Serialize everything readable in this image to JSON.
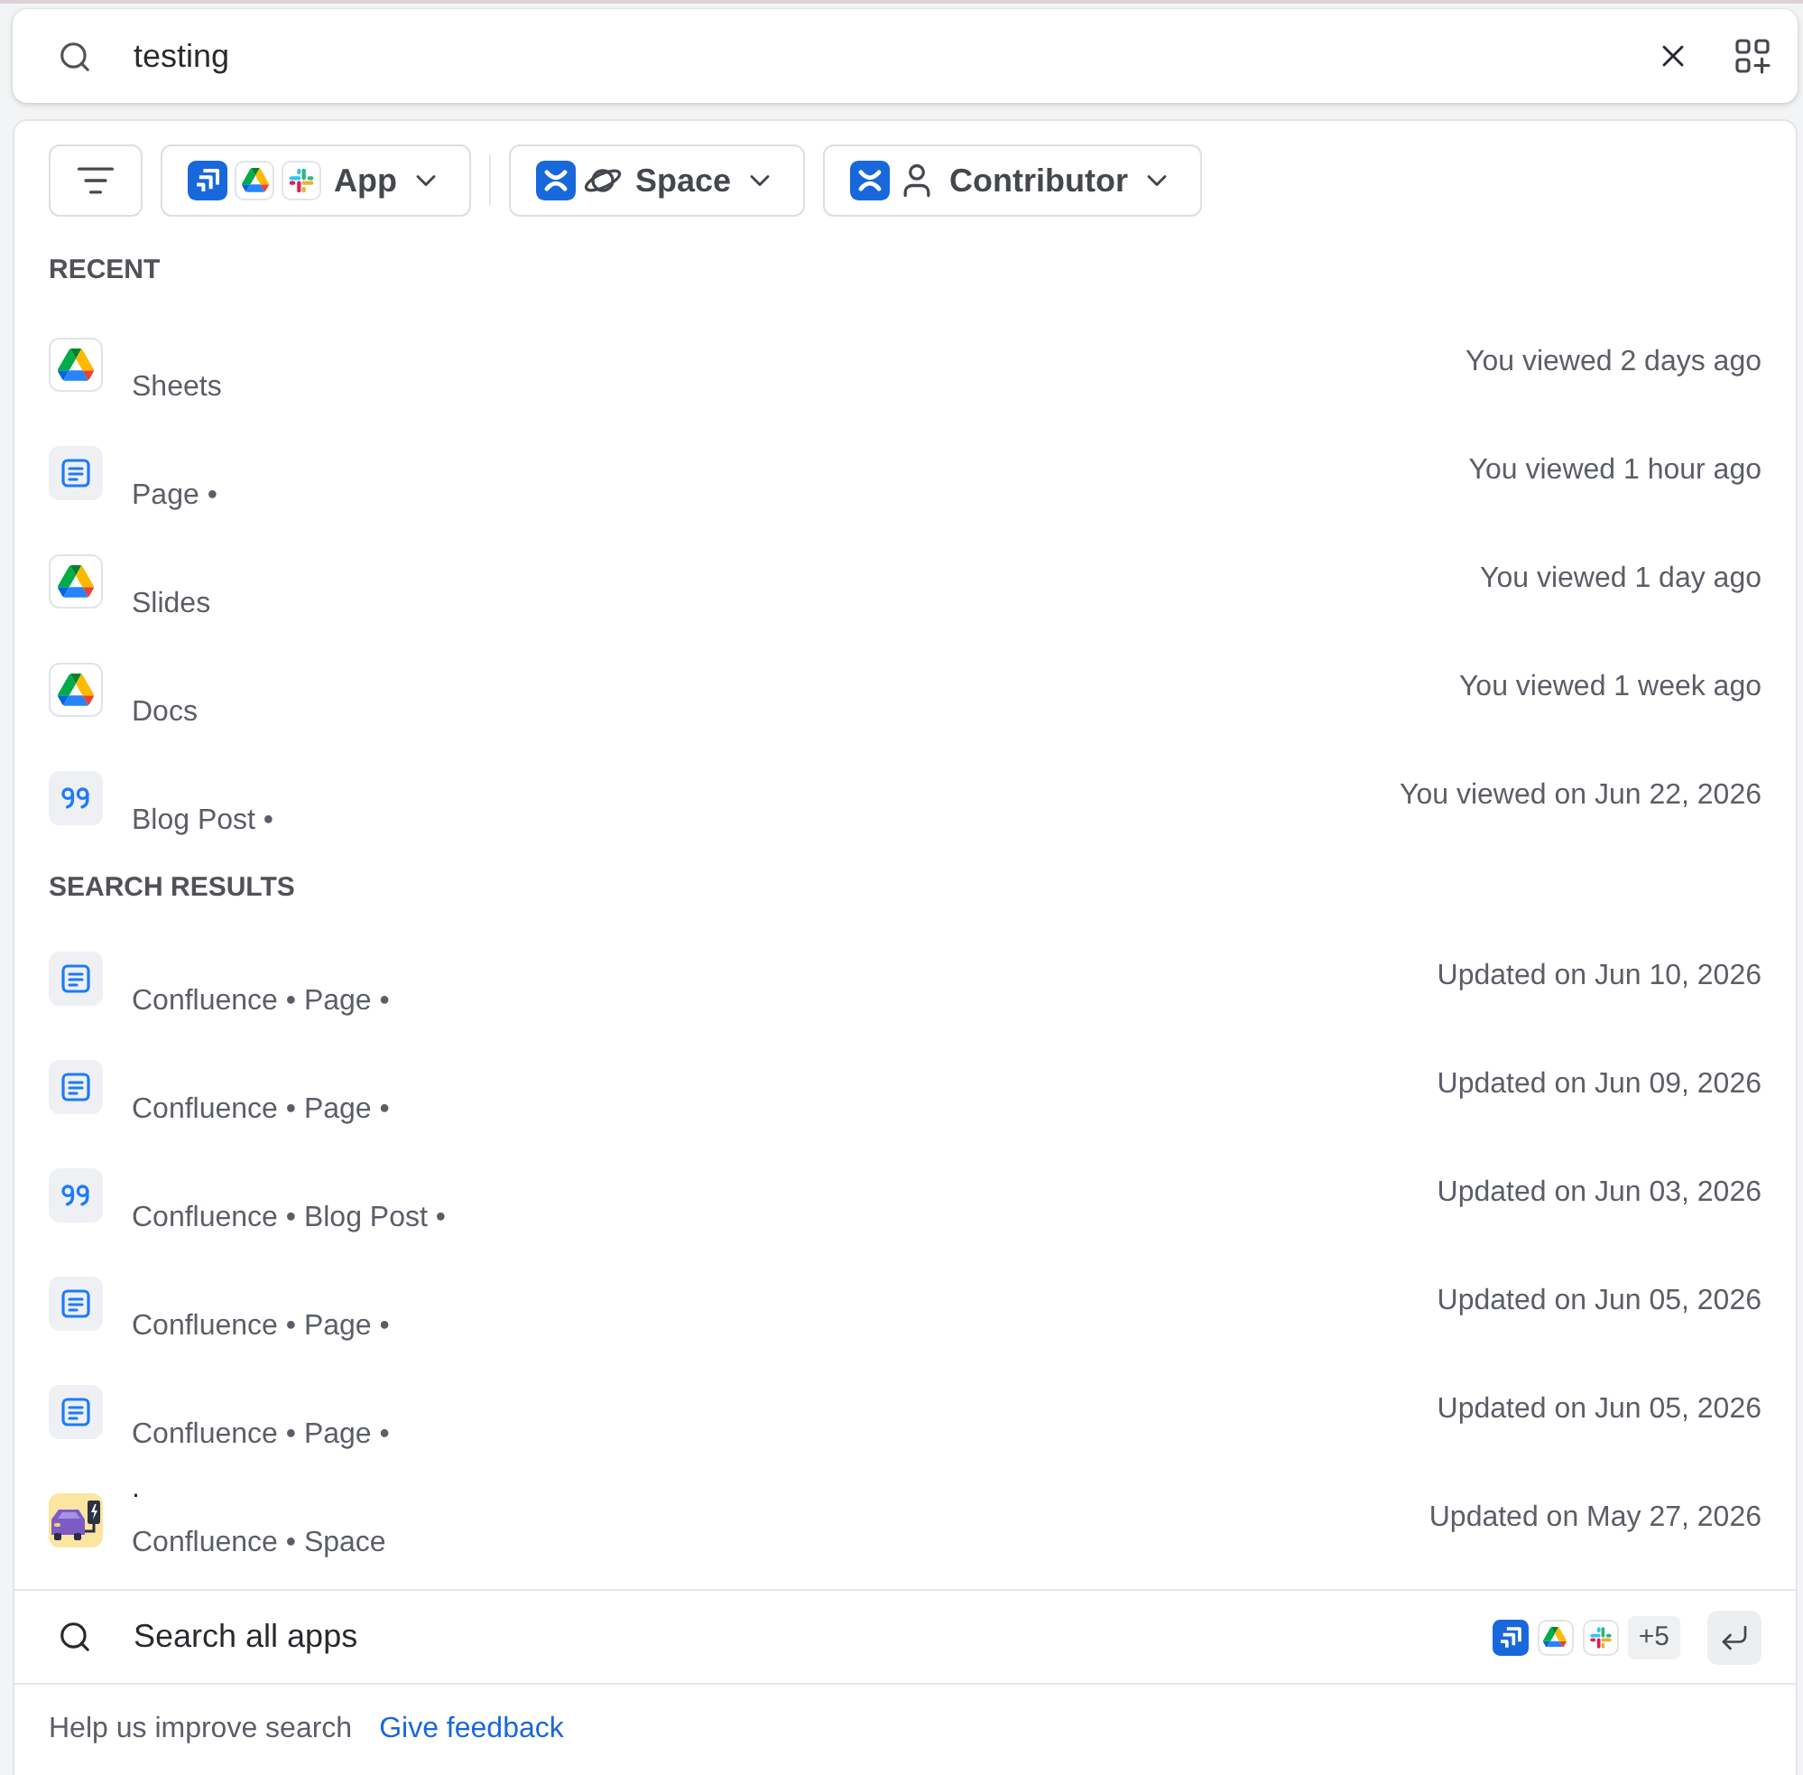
{
  "search": {
    "value": "testing"
  },
  "filters": [
    {
      "kind": "app",
      "label": "App"
    },
    {
      "kind": "space",
      "label": "Space"
    },
    {
      "kind": "contributor",
      "label": "Contributor"
    }
  ],
  "sections": [
    {
      "heading": "RECENT",
      "items": [
        {
          "kind": "drive",
          "meta": "Sheets",
          "time": "You viewed 2 days ago"
        },
        {
          "kind": "page",
          "meta": "Page •",
          "time": "You viewed 1 hour ago"
        },
        {
          "kind": "drive",
          "meta": "Slides",
          "time": "You viewed 1 day ago"
        },
        {
          "kind": "drive",
          "meta": "Docs",
          "time": "You viewed 1 week ago"
        },
        {
          "kind": "blog",
          "meta": "Blog Post •",
          "time": "You viewed on Jun 22, 2026"
        }
      ]
    },
    {
      "heading": "SEARCH RESULTS",
      "items": [
        {
          "kind": "page",
          "meta": "Confluence • Page •",
          "time": "Updated on Jun 10, 2026"
        },
        {
          "kind": "page",
          "meta": "Confluence • Page •",
          "time": "Updated on Jun 09, 2026"
        },
        {
          "kind": "blog",
          "meta": "Confluence • Blog Post •",
          "time": "Updated on Jun 03, 2026"
        },
        {
          "kind": "page",
          "meta": "Confluence • Page •",
          "time": "Updated on Jun 05, 2026"
        },
        {
          "kind": "page",
          "meta": "Confluence • Page •",
          "time": "Updated on Jun 05, 2026"
        },
        {
          "kind": "space",
          "title": ".",
          "meta": "Confluence • Space",
          "time": "Updated on May 27, 2026"
        }
      ]
    }
  ],
  "search_all": {
    "label": "Search all apps",
    "more_count": "+5"
  },
  "feedback": {
    "prompt": "Help us improve search",
    "link": "Give feedback"
  }
}
